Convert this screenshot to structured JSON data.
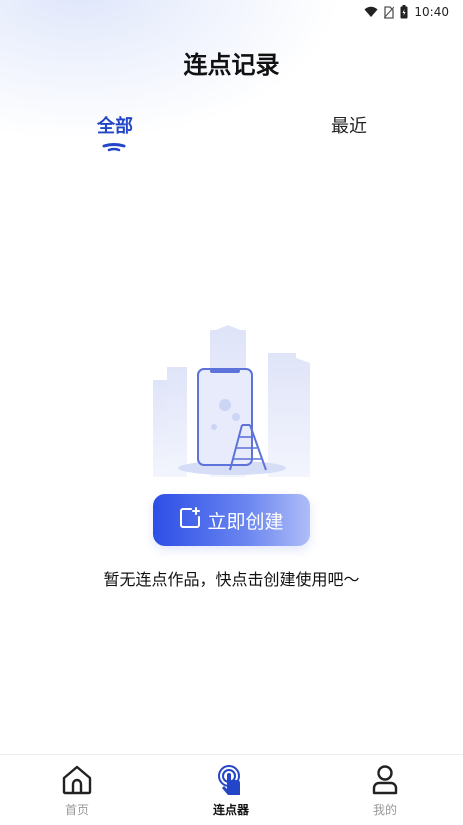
{
  "status_bar": {
    "time": "10:40",
    "icons": [
      "wifi-icon",
      "sim-off-icon",
      "battery-icon"
    ]
  },
  "header": {
    "title": "连点记录"
  },
  "tabs": [
    {
      "label": "全部",
      "active": true
    },
    {
      "label": "最近",
      "active": false
    }
  ],
  "empty_state": {
    "illustration": "phone-city-ladder-illustration",
    "button_label": "立即创建",
    "button_icon": "add-file-icon",
    "message": "暂无连点作品，快点击创建使用吧～"
  },
  "bottom_nav": [
    {
      "label": "首页",
      "icon": "home-icon",
      "active": false
    },
    {
      "label": "连点器",
      "icon": "tap-finger-icon",
      "active": true
    },
    {
      "label": "我的",
      "icon": "user-icon",
      "active": false
    }
  ],
  "colors": {
    "accent": "#2346c9",
    "button_start": "#2c4ee6",
    "button_end": "#aebdf7",
    "inactive_text": "#999999"
  }
}
